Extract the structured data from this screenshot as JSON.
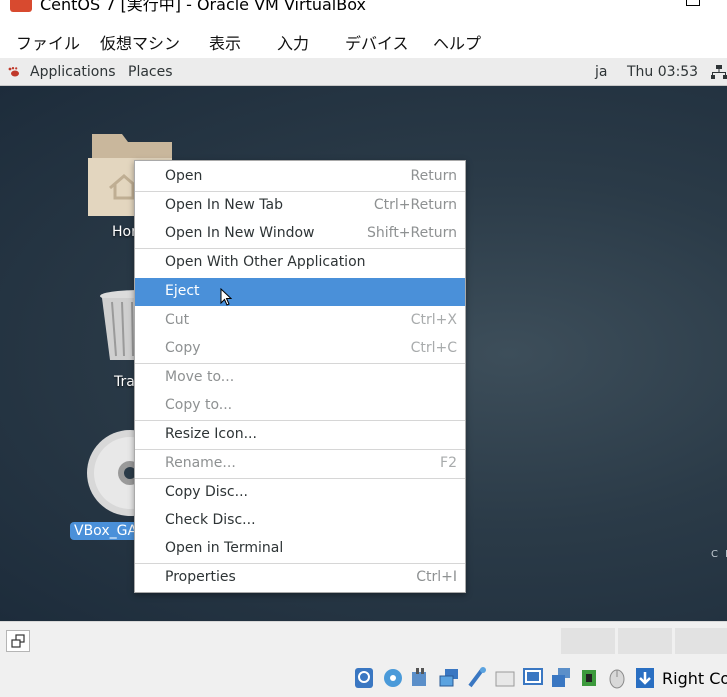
{
  "window": {
    "title": "CentOS 7 [実行中] - Oracle VM VirtualBox"
  },
  "menubar": {
    "items": [
      "ファイル",
      "仮想マシン",
      "表示",
      "入力",
      "デバイス",
      "ヘルプ"
    ]
  },
  "guest_topbar": {
    "applications": "Applications",
    "places": "Places",
    "input_method": "ja",
    "clock": "Thu 03:53"
  },
  "desktop": {
    "icons": [
      {
        "label": "Home",
        "visible_label": "Hom"
      },
      {
        "label": "Trash",
        "visible_label": "Tra"
      },
      {
        "label": "VBox_GAs",
        "visible_label": "VBox_GA"
      }
    ],
    "corner_text": "C E"
  },
  "context_menu": {
    "items": [
      {
        "label": "Open",
        "accel": "Return",
        "enabled": true
      },
      {
        "label": "Open In New Tab",
        "accel": "Ctrl+Return",
        "enabled": true
      },
      {
        "label": "Open In New Window",
        "accel": "Shift+Return",
        "enabled": true
      },
      {
        "label": "Open With Other Application",
        "accel": "",
        "enabled": true
      },
      {
        "label": "Eject",
        "accel": "",
        "enabled": true,
        "highlighted": true
      },
      {
        "label": "Cut",
        "accel": "Ctrl+X",
        "enabled": false
      },
      {
        "label": "Copy",
        "accel": "Ctrl+C",
        "enabled": false
      },
      {
        "label": "Move to...",
        "accel": "",
        "enabled": false
      },
      {
        "label": "Copy to...",
        "accel": "",
        "enabled": false
      },
      {
        "label": "Resize Icon...",
        "accel": "",
        "enabled": true
      },
      {
        "label": "Rename...",
        "accel": "F2",
        "enabled": false
      },
      {
        "label": "Copy Disc...",
        "accel": "",
        "enabled": true
      },
      {
        "label": "Check Disc...",
        "accel": "",
        "enabled": true
      },
      {
        "label": "Open in Terminal",
        "accel": "",
        "enabled": true
      },
      {
        "label": "Properties",
        "accel": "Ctrl+I",
        "enabled": true
      }
    ]
  },
  "statusbar": {
    "host_key": "Right Co"
  },
  "colors": {
    "highlight": "#4a90d9",
    "desktop": "#2b3b48",
    "menu_text": "#2e3436",
    "disabled_text": "#8e9192"
  }
}
